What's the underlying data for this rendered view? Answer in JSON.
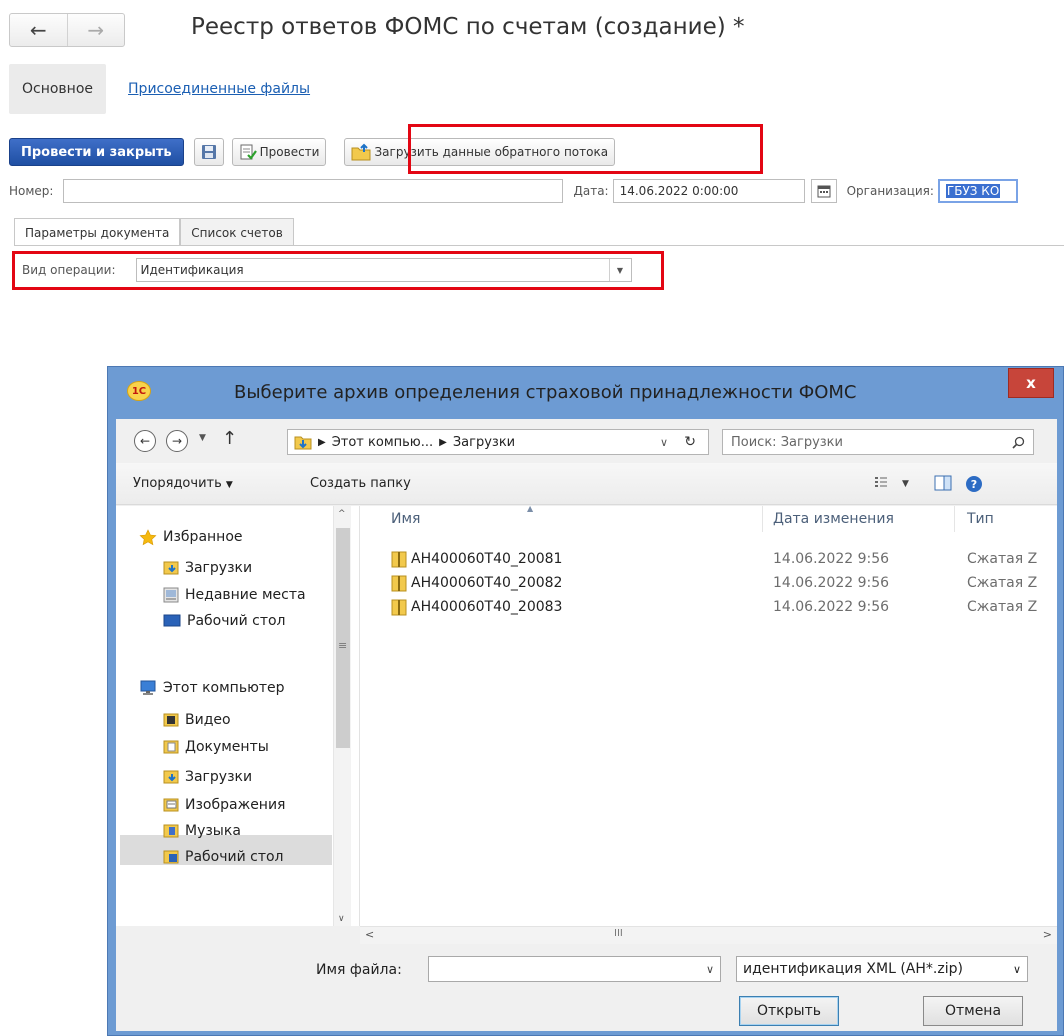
{
  "form": {
    "back_glyph": "←",
    "forward_glyph": "→",
    "title": "Реестр ответов ФОМС по счетам (создание) *",
    "subtabs": {
      "main": "Основное",
      "attached": "Присоединенные файлы"
    },
    "toolbar": {
      "post_close": "Провести и закрыть",
      "post": "Провести",
      "load": "Загрузить данные обратного потока"
    },
    "fields": {
      "number_label": "Номер:",
      "number_value": "",
      "date_label": "Дата:",
      "date_value": "14.06.2022  0:00:00",
      "org_label": "Организация:",
      "org_value": "ГБУЗ КО"
    },
    "tabs": {
      "params": "Параметры документа",
      "invoices": "Список счетов"
    },
    "operation": {
      "label": "Вид операции:",
      "value": "Идентификация"
    }
  },
  "dialog": {
    "title": "Выберите архив определения страховой принадлежности ФОМС",
    "logo_text": "1С",
    "close_glyph": "x",
    "address": {
      "part1": "Этот компью...",
      "part2": "Загрузки"
    },
    "search_placeholder": "Поиск: Загрузки",
    "commands": {
      "organize": "Упорядочить",
      "new_folder": "Создать папку"
    },
    "nav": {
      "favorites": "Избранное",
      "fav_downloads": "Загрузки",
      "recent": "Недавние места",
      "desktop": "Рабочий стол",
      "computer": "Этот компьютер",
      "video": "Видео",
      "documents": "Документы",
      "downloads": "Загрузки",
      "pictures": "Изображения",
      "music": "Музыка",
      "desktop2": "Рабочий стол"
    },
    "columns": {
      "name": "Имя",
      "date": "Дата изменения",
      "type": "Тип"
    },
    "files": [
      {
        "name": "AH400060T40_20081",
        "date": "14.06.2022 9:56",
        "type": "Сжатая Z"
      },
      {
        "name": "AH400060T40_20082",
        "date": "14.06.2022 9:56",
        "type": "Сжатая Z"
      },
      {
        "name": "AH400060T40_20083",
        "date": "14.06.2022 9:56",
        "type": "Сжатая Z"
      }
    ],
    "hscroll_mid": "III",
    "filename_label": "Имя файла:",
    "filename_value": "",
    "filter": "идентификация XML (AH*.zip)",
    "open": "Открыть",
    "cancel": "Отмена"
  }
}
